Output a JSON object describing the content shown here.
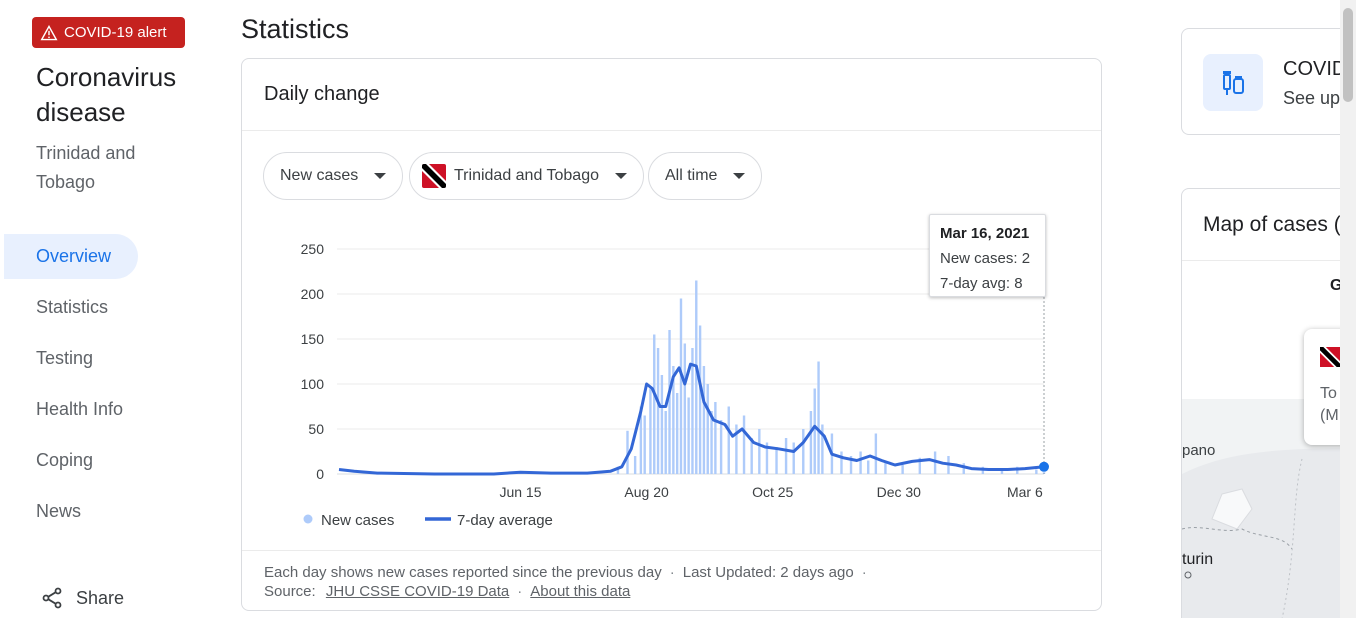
{
  "alert": {
    "label": "COVID-19 alert",
    "icon": "warning-icon"
  },
  "sidebar": {
    "title": "Coronavirus disease",
    "subtitle": "Trinidad and Tobago",
    "items": [
      {
        "label": "Overview",
        "active": true
      },
      {
        "label": "Statistics",
        "active": false
      },
      {
        "label": "Testing",
        "active": false
      },
      {
        "label": "Health Info",
        "active": false
      },
      {
        "label": "Coping",
        "active": false
      },
      {
        "label": "News",
        "active": false
      }
    ],
    "share_label": "Share"
  },
  "main": {
    "section_title": "Statistics",
    "card_title": "Daily change",
    "filters": {
      "metric": "New cases",
      "region": "Trinidad and Tobago",
      "range": "All time"
    },
    "tooltip": {
      "date": "Mar 16, 2021",
      "new_cases": "New cases: 2",
      "avg": "7-day avg: 8"
    },
    "legend": {
      "bars": "New cases",
      "line": "7-day average"
    },
    "footer": {
      "note": "Each day shows new cases reported since the previous day",
      "updated": "Last Updated: 2 days ago",
      "source_prefix": "Source:",
      "source_link": "JHU CSSE COVID-19 Data",
      "about_link": "About this data"
    }
  },
  "right": {
    "vaccine_title": "COVID",
    "vaccine_sub": "See up",
    "map_title": "Map of cases (",
    "map_letter": "G",
    "popup_line1": "To",
    "popup_line2": "(M",
    "map_place1": "pano",
    "map_place2": "turin"
  },
  "colors": {
    "bars": "#aecbfa",
    "line": "#3367d6",
    "accent": "#1a73e8",
    "alert": "#c5221f"
  },
  "chart_data": {
    "type": "bar",
    "title": "",
    "xlabel": "",
    "ylabel": "",
    "ylim": [
      0,
      250
    ],
    "y_ticks": [
      0,
      50,
      100,
      150,
      200,
      250
    ],
    "x_tick_labels": [
      "Jun 15",
      "Aug 20",
      "Oct 25",
      "Dec 30",
      "Mar 6"
    ],
    "x_tick_dates": [
      "2020-06-15",
      "2020-08-20",
      "2020-10-25",
      "2020-12-30",
      "2021-03-06"
    ],
    "x_start": "2020-03-12",
    "x_end": "2021-03-16",
    "series": [
      {
        "name": "New cases",
        "kind": "bar",
        "points": [
          [
            "2020-08-05",
            8
          ],
          [
            "2020-08-10",
            48
          ],
          [
            "2020-08-14",
            20
          ],
          [
            "2020-08-17",
            75
          ],
          [
            "2020-08-19",
            65
          ],
          [
            "2020-08-22",
            95
          ],
          [
            "2020-08-24",
            155
          ],
          [
            "2020-08-26",
            140
          ],
          [
            "2020-08-28",
            110
          ],
          [
            "2020-08-30",
            70
          ],
          [
            "2020-09-01",
            160
          ],
          [
            "2020-09-03",
            120
          ],
          [
            "2020-09-05",
            90
          ],
          [
            "2020-09-07",
            195
          ],
          [
            "2020-09-09",
            145
          ],
          [
            "2020-09-11",
            85
          ],
          [
            "2020-09-13",
            140
          ],
          [
            "2020-09-15",
            215
          ],
          [
            "2020-09-17",
            165
          ],
          [
            "2020-09-19",
            120
          ],
          [
            "2020-09-21",
            100
          ],
          [
            "2020-09-23",
            70
          ],
          [
            "2020-09-25",
            80
          ],
          [
            "2020-09-28",
            60
          ],
          [
            "2020-10-02",
            75
          ],
          [
            "2020-10-06",
            55
          ],
          [
            "2020-10-10",
            65
          ],
          [
            "2020-10-14",
            40
          ],
          [
            "2020-10-18",
            50
          ],
          [
            "2020-10-22",
            35
          ],
          [
            "2020-10-27",
            30
          ],
          [
            "2020-11-01",
            40
          ],
          [
            "2020-11-05",
            35
          ],
          [
            "2020-11-10",
            50
          ],
          [
            "2020-11-14",
            70
          ],
          [
            "2020-11-16",
            95
          ],
          [
            "2020-11-18",
            125
          ],
          [
            "2020-11-20",
            55
          ],
          [
            "2020-11-25",
            45
          ],
          [
            "2020-11-30",
            25
          ],
          [
            "2020-12-05",
            20
          ],
          [
            "2020-12-10",
            25
          ],
          [
            "2020-12-14",
            15
          ],
          [
            "2020-12-18",
            45
          ],
          [
            "2020-12-23",
            12
          ],
          [
            "2021-01-01",
            10
          ],
          [
            "2021-01-10",
            18
          ],
          [
            "2021-01-18",
            25
          ],
          [
            "2021-01-25",
            20
          ],
          [
            "2021-02-02",
            12
          ],
          [
            "2021-02-12",
            8
          ],
          [
            "2021-02-22",
            6
          ],
          [
            "2021-03-02",
            8
          ],
          [
            "2021-03-12",
            5
          ],
          [
            "2021-03-16",
            2
          ]
        ]
      },
      {
        "name": "7-day average",
        "kind": "line",
        "points": [
          [
            "2020-03-12",
            5
          ],
          [
            "2020-03-20",
            3
          ],
          [
            "2020-04-01",
            1
          ],
          [
            "2020-05-01",
            0
          ],
          [
            "2020-06-01",
            0
          ],
          [
            "2020-06-15",
            2
          ],
          [
            "2020-07-01",
            1
          ],
          [
            "2020-07-20",
            1
          ],
          [
            "2020-08-01",
            3
          ],
          [
            "2020-08-07",
            8
          ],
          [
            "2020-08-12",
            28
          ],
          [
            "2020-08-17",
            70
          ],
          [
            "2020-08-20",
            100
          ],
          [
            "2020-08-23",
            95
          ],
          [
            "2020-08-27",
            75
          ],
          [
            "2020-08-30",
            75
          ],
          [
            "2020-09-03",
            108
          ],
          [
            "2020-09-06",
            118
          ],
          [
            "2020-09-09",
            100
          ],
          [
            "2020-09-12",
            122
          ],
          [
            "2020-09-15",
            120
          ],
          [
            "2020-09-19",
            80
          ],
          [
            "2020-09-24",
            60
          ],
          [
            "2020-09-30",
            55
          ],
          [
            "2020-10-04",
            42
          ],
          [
            "2020-10-09",
            50
          ],
          [
            "2020-10-15",
            35
          ],
          [
            "2020-10-21",
            30
          ],
          [
            "2020-10-28",
            28
          ],
          [
            "2020-11-05",
            25
          ],
          [
            "2020-11-10",
            35
          ],
          [
            "2020-11-16",
            53
          ],
          [
            "2020-11-21",
            42
          ],
          [
            "2020-11-25",
            22
          ],
          [
            "2020-12-01",
            18
          ],
          [
            "2020-12-08",
            15
          ],
          [
            "2020-12-15",
            20
          ],
          [
            "2020-12-21",
            15
          ],
          [
            "2020-12-28",
            10
          ],
          [
            "2021-01-06",
            14
          ],
          [
            "2021-01-15",
            16
          ],
          [
            "2021-01-22",
            12
          ],
          [
            "2021-01-29",
            10
          ],
          [
            "2021-02-06",
            6
          ],
          [
            "2021-02-15",
            5
          ],
          [
            "2021-02-25",
            5
          ],
          [
            "2021-03-06",
            6
          ],
          [
            "2021-03-16",
            8
          ]
        ]
      }
    ],
    "highlight": {
      "date": "2021-03-16",
      "value": 8
    },
    "legend_position": "bottom-left",
    "grid": true
  }
}
